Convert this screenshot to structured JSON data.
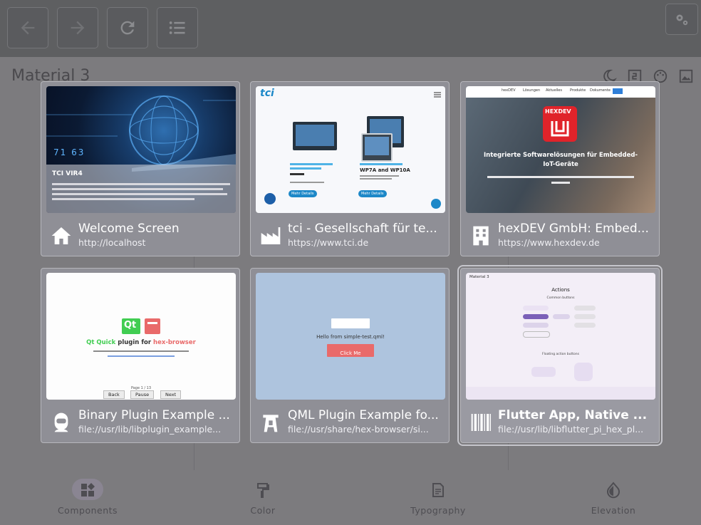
{
  "app": {
    "title": "Material 3",
    "nav": [
      {
        "label": "Components",
        "icon": "widgets-icon"
      },
      {
        "label": "Color",
        "icon": "format-paint-icon"
      },
      {
        "label": "Typography",
        "icon": "text-snippet-icon"
      },
      {
        "label": "Elevation",
        "icon": "opacity-icon"
      }
    ]
  },
  "toolbar": {
    "back": "back-icon",
    "forward": "forward-icon",
    "reload": "reload-icon",
    "menu": "list-icon",
    "settings": "settings-icon"
  },
  "cards": [
    {
      "title": "Welcome Screen",
      "url": "http://localhost",
      "icon": "home-icon",
      "thumb": {
        "heading": "TCI VIR4",
        "digits": "71  63"
      }
    },
    {
      "title": "tci - Gesellschaft für te...",
      "url": "https://www.tci.de",
      "icon": "factory-icon",
      "thumb": {
        "logo": "tci",
        "product_a": "WP7A and WP10A",
        "button_a": "Mehr Details",
        "button_b": "Mehr Details"
      }
    },
    {
      "title": "hexDEV GmbH: Embed...",
      "url": "https://www.hexdev.de",
      "icon": "apartment-icon",
      "thumb": {
        "logo": "HEXDEV",
        "headline_1": "Integrierte Softwarelösungen für Embedded-",
        "headline_2": "IoT-Geräte",
        "nav": [
          "hexDEV",
          "Lösungen",
          "Aktuelles",
          "Produkte",
          "Dokumente"
        ]
      }
    },
    {
      "title": "Binary Plugin Example ...",
      "url": "file://usr/lib/libplugin_example...",
      "icon": "robot-icon",
      "thumb": {
        "qt": "Qt",
        "heading_a": "Qt Quick",
        "heading_b": " plugin for ",
        "heading_c": "hex-browser",
        "page": "Page 1 / 13",
        "back": "Back",
        "pause": "Pause",
        "next": "Next"
      }
    },
    {
      "title": "QML Plugin Example fo...",
      "url": "file://usr/share/hex-browser/si...",
      "icon": "tower-icon",
      "thumb": {
        "text": "Hello from simple-test.qml!",
        "button": "Click Me"
      }
    },
    {
      "title": "Flutter App, Native ...",
      "url": "file://usr/lib/libflutter_pi_hex_pl...",
      "icon": "barcode-icon",
      "selected": true,
      "thumb": {
        "app_title": "Material 3",
        "heading": "Actions",
        "sub": "Common buttons",
        "fab_sub": "Floating action buttons"
      }
    }
  ],
  "colors": {
    "accent_pink": "#e96a6a",
    "qt_green": "#41cd52",
    "hex_red": "#e0232a"
  }
}
